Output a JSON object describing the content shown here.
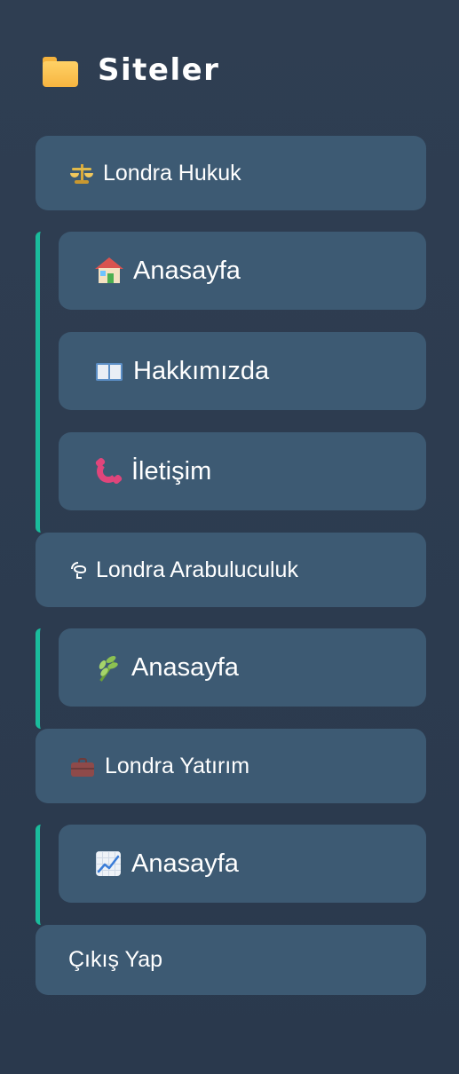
{
  "sidebar": {
    "title": "Siteler",
    "title_icon": "folder-icon",
    "sites": [
      {
        "label": "Londra Hukuk",
        "icon": "scale-icon",
        "pages": [
          {
            "label": "Anasayfa",
            "icon": "house-icon"
          },
          {
            "label": "Hakkımızda",
            "icon": "book-icon"
          },
          {
            "label": "İletişim",
            "icon": "phone-icon"
          }
        ]
      },
      {
        "label": "Londra Arabuluculuk",
        "icon": "dove-icon",
        "pages": [
          {
            "label": "Anasayfa",
            "icon": "herb-icon"
          }
        ]
      },
      {
        "label": "Londra Yatırım",
        "icon": "briefcase-icon",
        "pages": [
          {
            "label": "Anasayfa",
            "icon": "chart-increasing-icon"
          }
        ]
      }
    ],
    "logout_label": "Çıkış Yap"
  },
  "colors": {
    "background": "#2f3e52",
    "card": "#3d5a73",
    "accent": "#1abc9c",
    "text": "#ffffff"
  }
}
